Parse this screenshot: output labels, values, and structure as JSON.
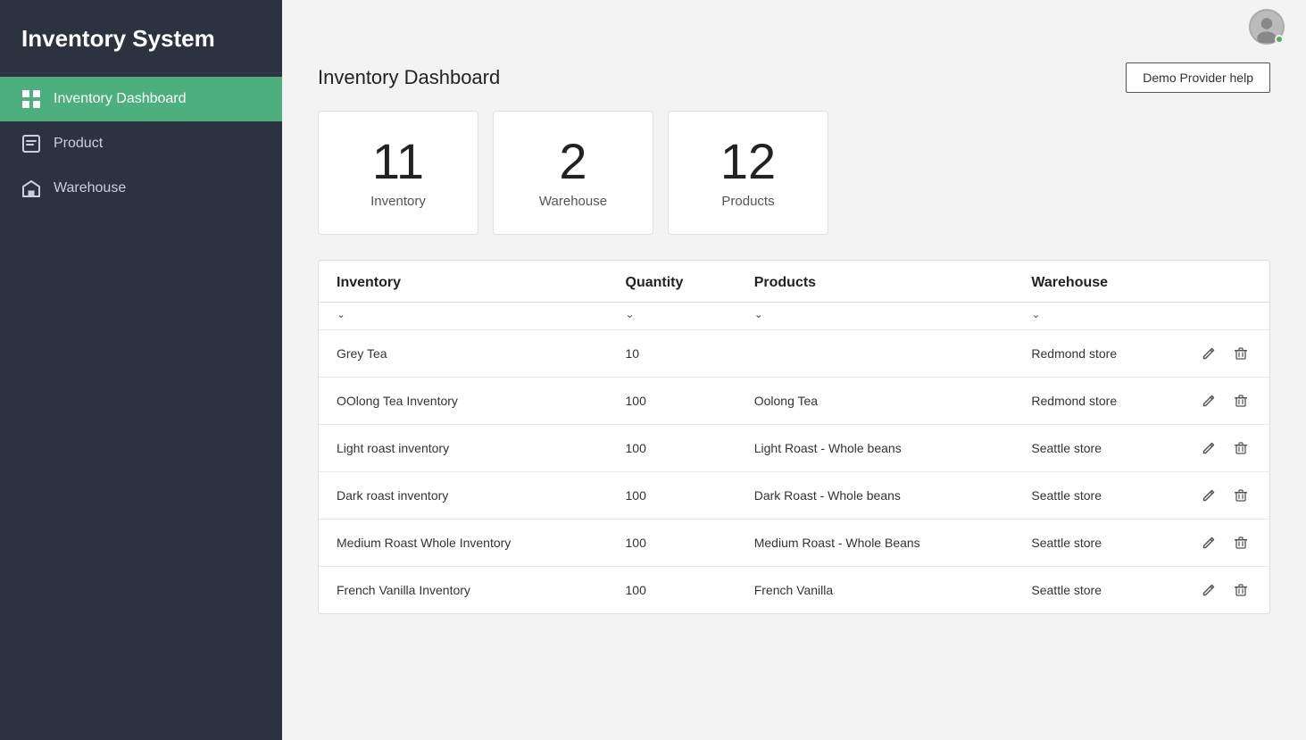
{
  "app": {
    "title": "Inventory System"
  },
  "sidebar": {
    "nav_items": [
      {
        "id": "dashboard",
        "label": "Inventory Dashboard",
        "icon": "dashboard-icon",
        "active": true
      },
      {
        "id": "product",
        "label": "Product",
        "icon": "product-icon",
        "active": false
      },
      {
        "id": "warehouse",
        "label": "Warehouse",
        "icon": "warehouse-icon",
        "active": false
      }
    ]
  },
  "header": {
    "page_title": "Inventory Dashboard",
    "help_button": "Demo Provider help"
  },
  "stat_cards": [
    {
      "id": "inventory-count",
      "number": "11",
      "label": "Inventory"
    },
    {
      "id": "warehouse-count",
      "number": "2",
      "label": "Warehouse"
    },
    {
      "id": "products-count",
      "number": "12",
      "label": "Products"
    }
  ],
  "table": {
    "columns": [
      "Inventory",
      "Quantity",
      "Products",
      "Warehouse"
    ],
    "rows": [
      {
        "inventory": "Grey Tea",
        "quantity": "10",
        "products": "",
        "warehouse": "Redmond store"
      },
      {
        "inventory": "OOlong Tea Inventory",
        "quantity": "100",
        "products": "Oolong Tea",
        "warehouse": "Redmond store"
      },
      {
        "inventory": "Light roast inventory",
        "quantity": "100",
        "products": "Light Roast - Whole beans",
        "warehouse": "Seattle store"
      },
      {
        "inventory": "Dark roast inventory",
        "quantity": "100",
        "products": "Dark Roast - Whole beans",
        "warehouse": "Seattle store"
      },
      {
        "inventory": "Medium Roast Whole Inventory",
        "quantity": "100",
        "products": "Medium Roast - Whole Beans",
        "warehouse": "Seattle store"
      },
      {
        "inventory": "French Vanilla Inventory",
        "quantity": "100",
        "products": "French Vanilla",
        "warehouse": "Seattle store"
      }
    ]
  }
}
